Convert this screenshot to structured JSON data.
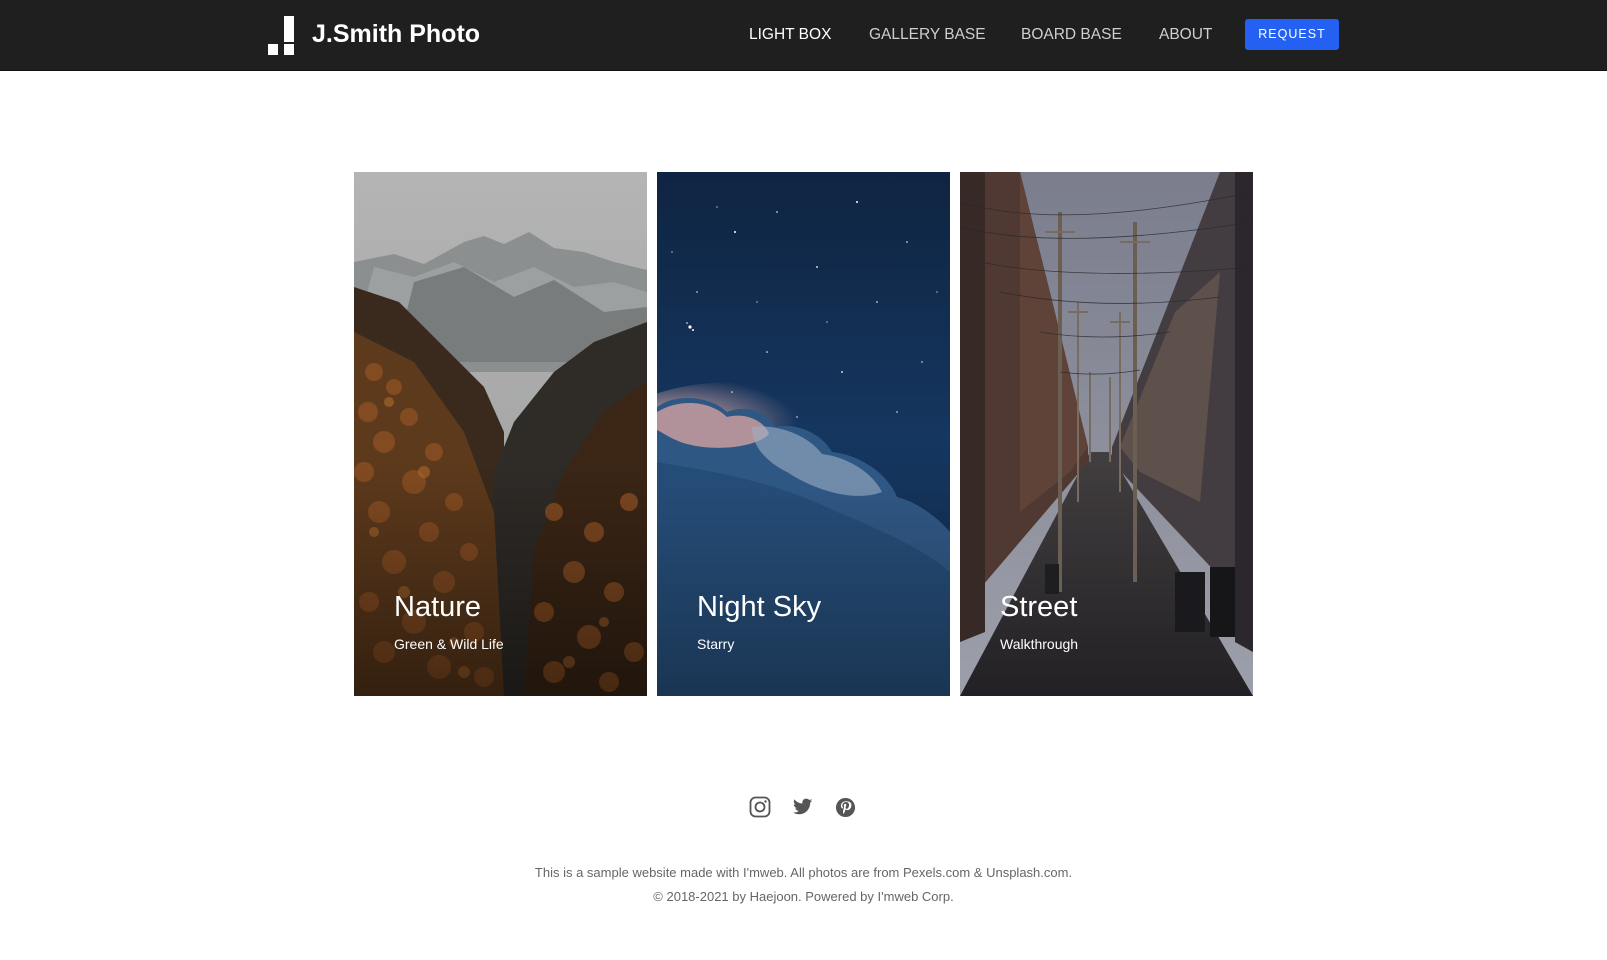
{
  "header": {
    "brand": "J.Smith Photo",
    "logo_icon": "bar-chart-logo-icon",
    "nav": [
      {
        "label": "LIGHT BOX",
        "active": true
      },
      {
        "label": "GALLERY BASE",
        "active": false
      },
      {
        "label": "BOARD BASE",
        "active": false
      },
      {
        "label": "ABOUT",
        "active": false
      }
    ],
    "request_label": "REQUEST",
    "colors": {
      "background": "#1f1f1f",
      "accent": "#2461f3"
    }
  },
  "gallery": {
    "cards": [
      {
        "title": "Nature",
        "subtitle": "Green & Wild Life",
        "image": "mountain-forest-photo"
      },
      {
        "title": "Night Sky",
        "subtitle": "Starry",
        "image": "starry-sky-clouds-photo"
      },
      {
        "title": "Street",
        "subtitle": "Walkthrough",
        "image": "alley-power-lines-photo"
      }
    ]
  },
  "footer": {
    "social": [
      "instagram-icon",
      "twitter-icon",
      "pinterest-icon"
    ],
    "line1": "This is a sample website made with I'mweb. All photos are from Pexels.com & Unsplash.com.",
    "line2": "© 2018-2021 by Haejoon. Powered by I'mweb Corp."
  }
}
